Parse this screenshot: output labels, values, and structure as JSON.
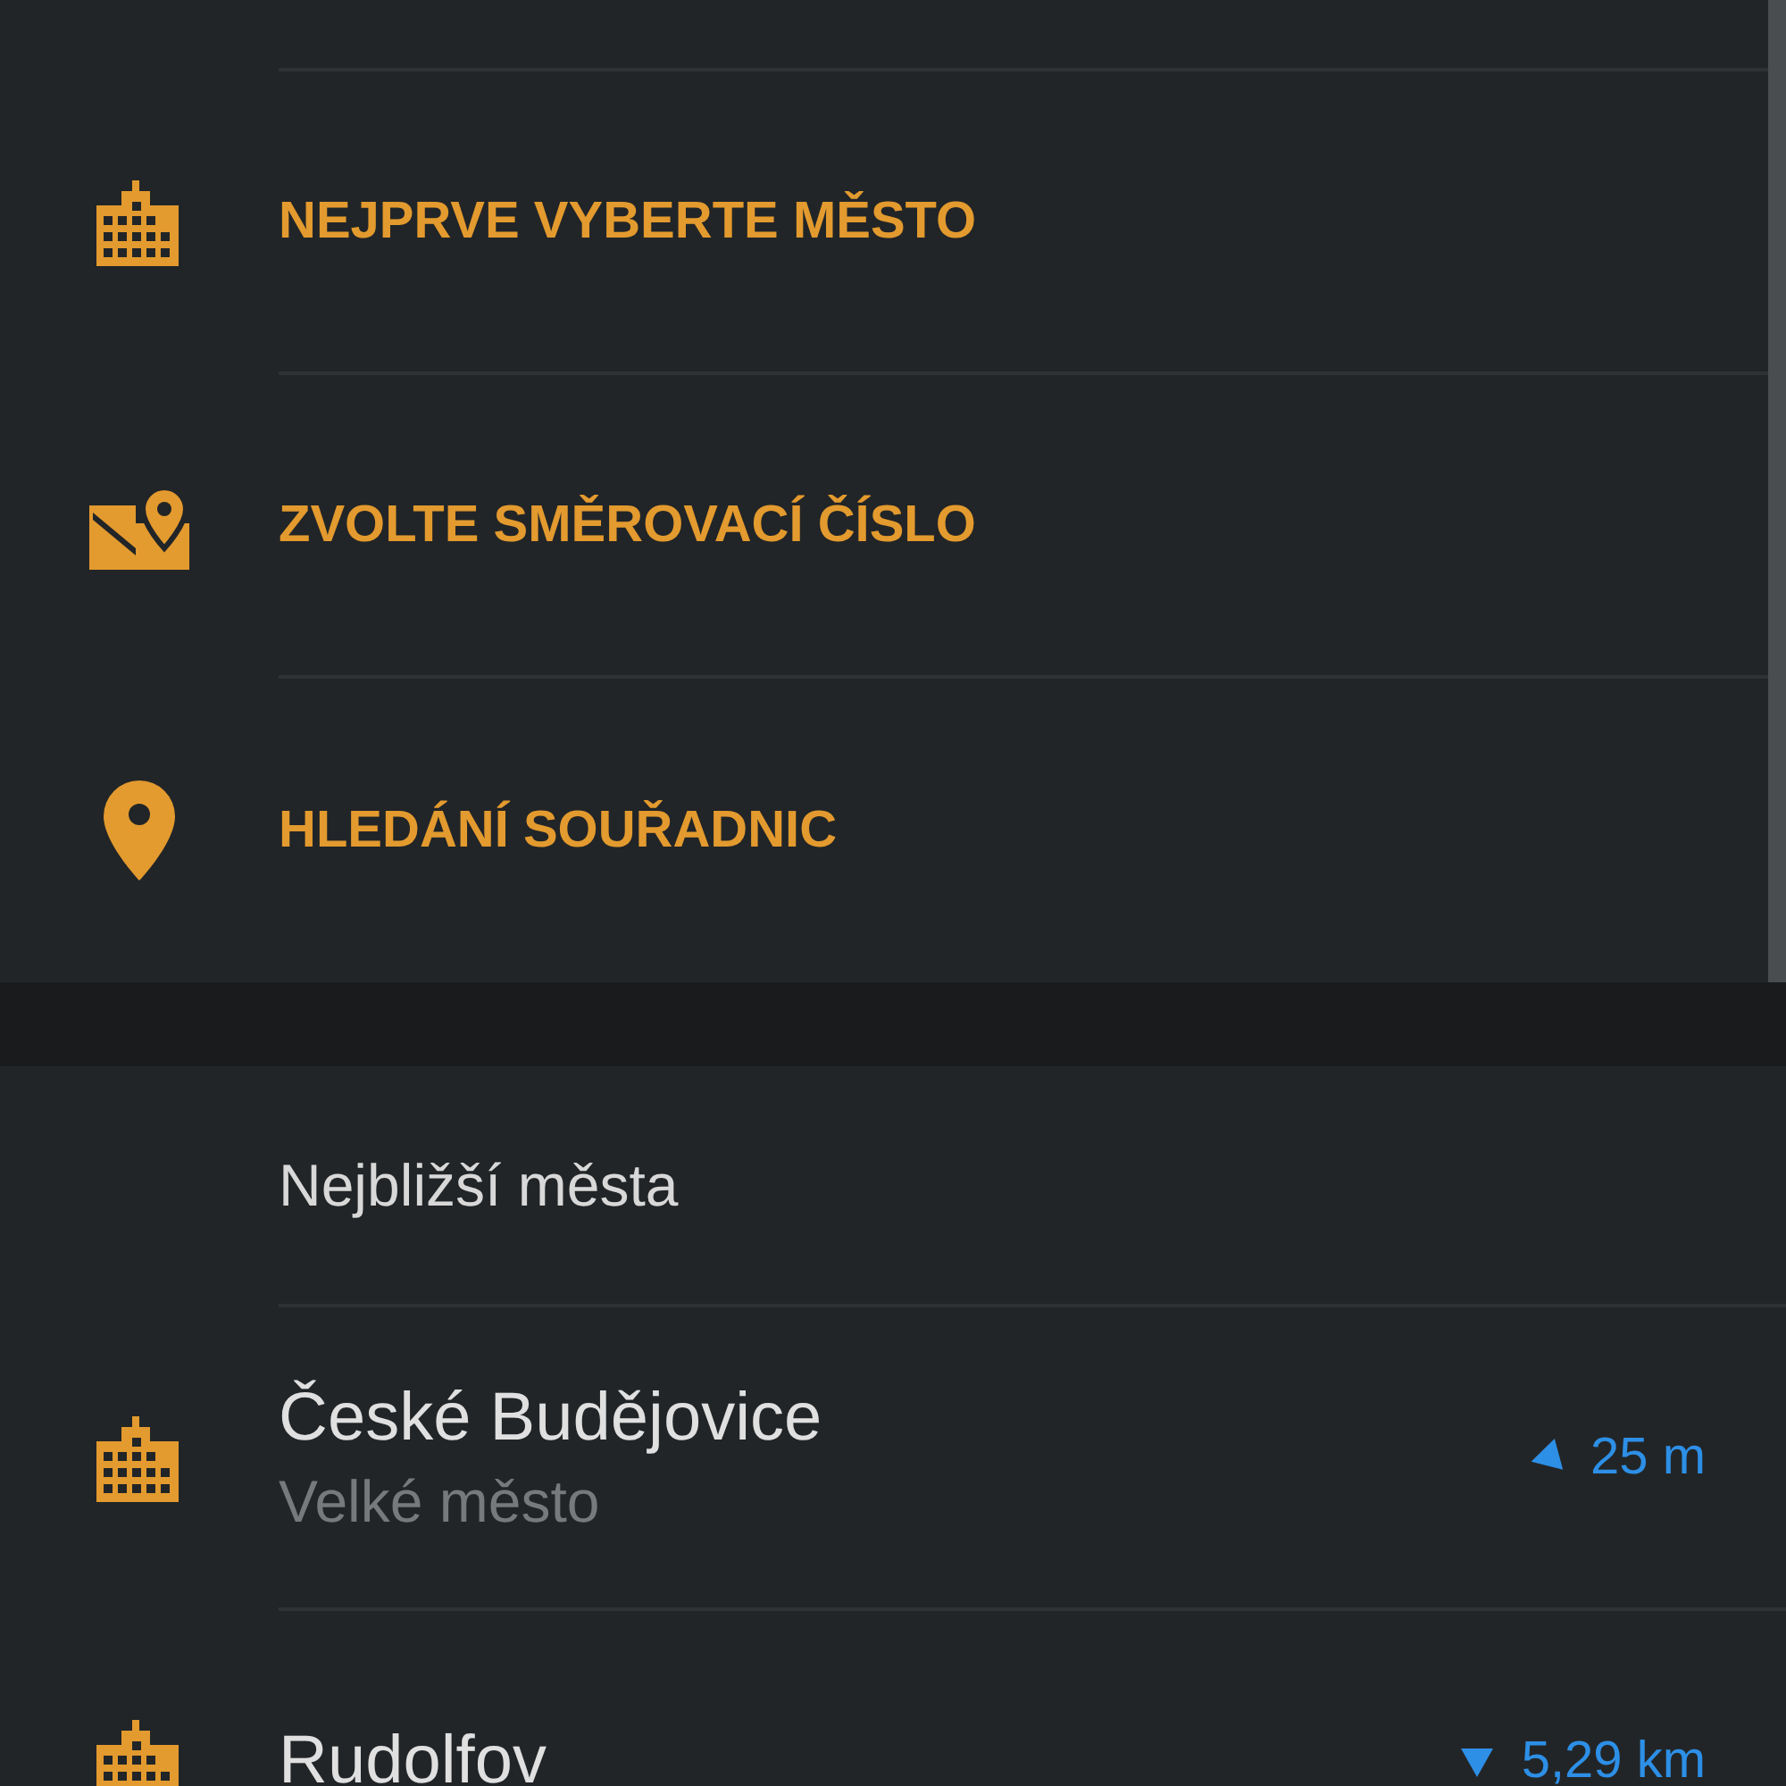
{
  "search_options": [
    {
      "label": "NEJPRVE VYBERTE MĚSTO"
    },
    {
      "label": "ZVOLTE SMĚROVACÍ ČÍSLO"
    },
    {
      "label": "HLEDÁNÍ SOUŘADNIC"
    }
  ],
  "nearest": {
    "title": "Nejbližší města",
    "items": [
      {
        "name": "České Budějovice",
        "type": "Velké město",
        "distance": "25 m"
      },
      {
        "name": "Rudolfov",
        "distance": "5,29 km"
      }
    ]
  }
}
